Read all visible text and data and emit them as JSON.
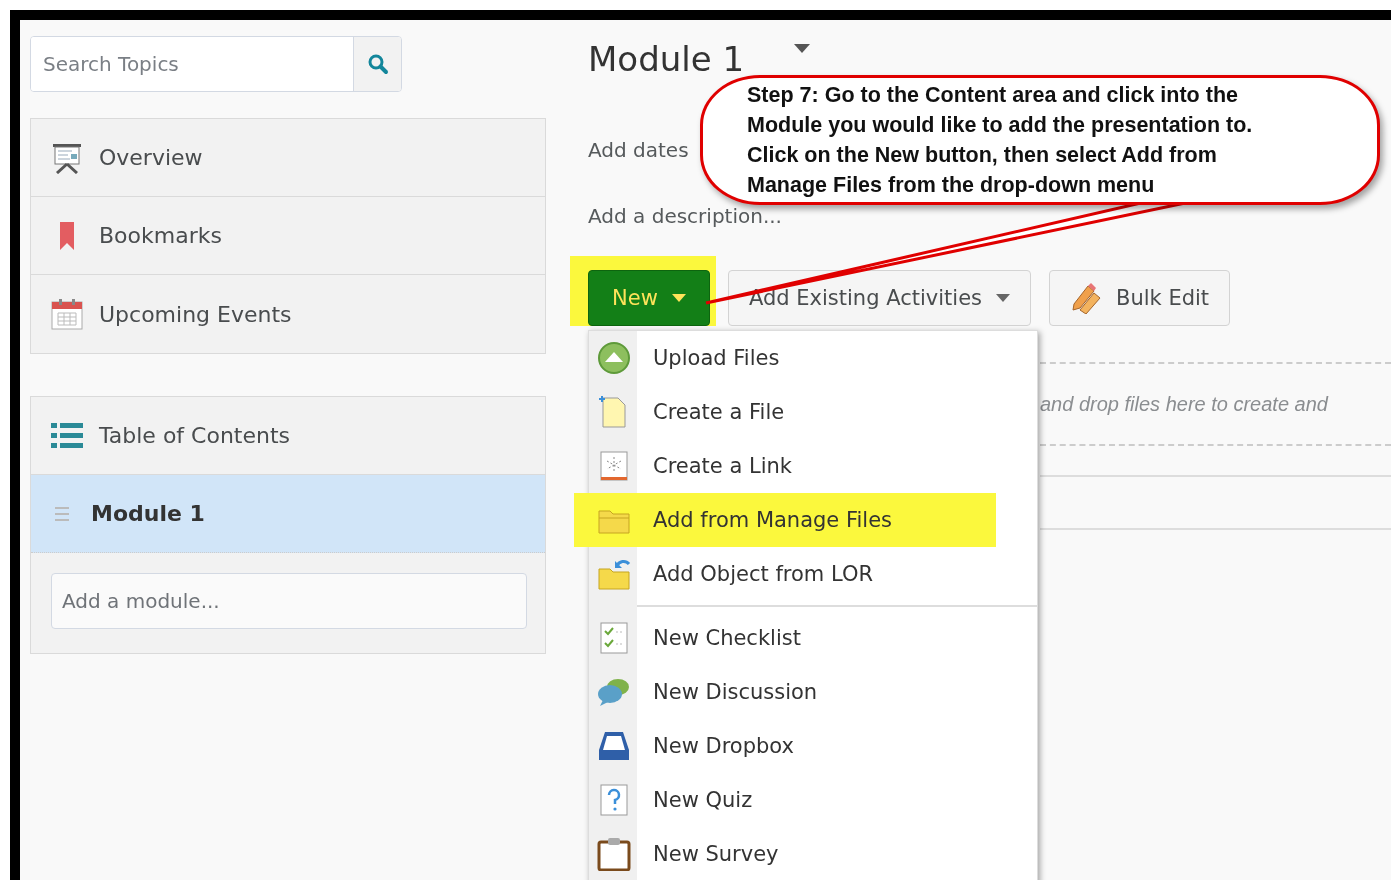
{
  "sidebar": {
    "search": {
      "placeholder": "Search Topics"
    },
    "nav": [
      {
        "label": "Overview"
      },
      {
        "label": "Bookmarks"
      },
      {
        "label": "Upcoming Events"
      }
    ],
    "toc": {
      "title": "Table of Contents",
      "modules": [
        {
          "label": "Module 1",
          "selected": true
        }
      ],
      "add_module": {
        "placeholder": "Add a module..."
      }
    }
  },
  "main": {
    "title": "Module 1",
    "add_dates": "Add dates",
    "add_description": "Add a description...",
    "buttons": [
      {
        "kind": "primary",
        "label": "New",
        "highlighted": true
      },
      {
        "kind": "dropdown",
        "label": "Add Existing Activities",
        "highlighted": false
      },
      {
        "kind": "bulk",
        "label": "Bulk Edit",
        "highlighted": false
      }
    ],
    "dropzone": "and drop files here to create and",
    "menu": {
      "sections": [
        {
          "items": [
            {
              "label": "Upload Files",
              "highlighted": false
            },
            {
              "label": "Create a File",
              "highlighted": false
            },
            {
              "label": "Create a Link",
              "highlighted": false
            },
            {
              "label": "Add from Manage Files",
              "highlighted": true
            },
            {
              "label": "Add Object from LOR",
              "highlighted": false
            }
          ]
        },
        {
          "items": [
            {
              "label": "New Checklist",
              "highlighted": false
            },
            {
              "label": "New Discussion",
              "highlighted": false
            },
            {
              "label": "New Dropbox",
              "highlighted": false
            },
            {
              "label": "New Quiz",
              "highlighted": false
            },
            {
              "label": "New Survey",
              "highlighted": false
            }
          ]
        }
      ]
    }
  },
  "callout": {
    "text": "Step 7: Go to the Content area and click into the Module you would like to add the presentation to. Click on the New button, then select Add from Manage Files from the drop-down menu"
  }
}
